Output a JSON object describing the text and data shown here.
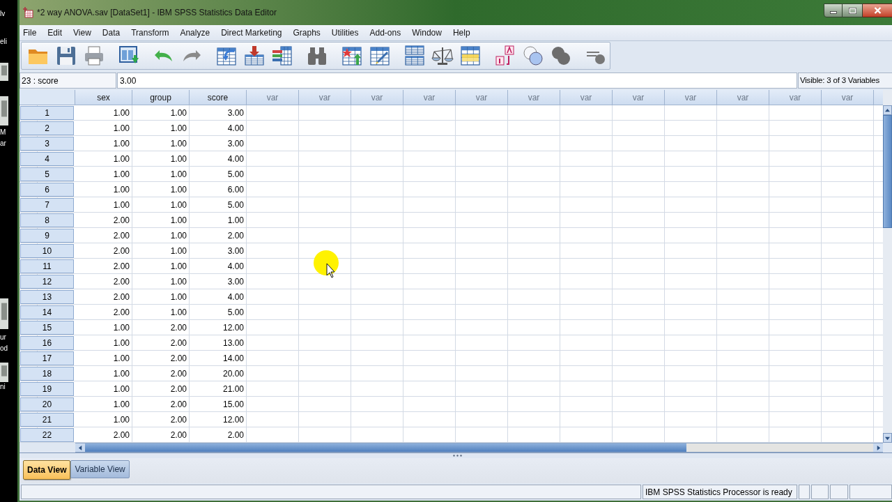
{
  "desktop": {
    "labels": [
      "lv",
      "eli",
      "M",
      "ar",
      "ur",
      "od",
      "ni"
    ]
  },
  "window": {
    "title": "*2 way ANOVA.sav [DataSet1] - IBM SPSS Statistics Data Editor"
  },
  "menu": [
    "File",
    "Edit",
    "View",
    "Data",
    "Transform",
    "Analyze",
    "Direct Marketing",
    "Graphs",
    "Utilities",
    "Add-ons",
    "Window",
    "Help"
  ],
  "cell_editor": {
    "cell": "23 : score",
    "value": "3.00",
    "visible": "Visible: 3 of 3 Variables"
  },
  "grid": {
    "columns": [
      {
        "name": "sex",
        "kind": "defined"
      },
      {
        "name": "group",
        "kind": "defined"
      },
      {
        "name": "score",
        "kind": "defined"
      },
      {
        "name": "var",
        "kind": "empty"
      },
      {
        "name": "var",
        "kind": "empty"
      },
      {
        "name": "var",
        "kind": "empty"
      },
      {
        "name": "var",
        "kind": "empty"
      },
      {
        "name": "var",
        "kind": "empty"
      },
      {
        "name": "var",
        "kind": "empty"
      },
      {
        "name": "var",
        "kind": "empty"
      },
      {
        "name": "var",
        "kind": "empty"
      },
      {
        "name": "var",
        "kind": "empty"
      },
      {
        "name": "var",
        "kind": "empty"
      },
      {
        "name": "var",
        "kind": "empty"
      },
      {
        "name": "var",
        "kind": "empty"
      }
    ],
    "rows": [
      {
        "number": "1",
        "cells": [
          "1.00",
          "1.00",
          "3.00"
        ]
      },
      {
        "number": "2",
        "cells": [
          "1.00",
          "1.00",
          "4.00"
        ]
      },
      {
        "number": "3",
        "cells": [
          "1.00",
          "1.00",
          "3.00"
        ]
      },
      {
        "number": "4",
        "cells": [
          "1.00",
          "1.00",
          "4.00"
        ]
      },
      {
        "number": "5",
        "cells": [
          "1.00",
          "1.00",
          "5.00"
        ]
      },
      {
        "number": "6",
        "cells": [
          "1.00",
          "1.00",
          "6.00"
        ]
      },
      {
        "number": "7",
        "cells": [
          "1.00",
          "1.00",
          "5.00"
        ]
      },
      {
        "number": "8",
        "cells": [
          "2.00",
          "1.00",
          "1.00"
        ]
      },
      {
        "number": "9",
        "cells": [
          "2.00",
          "1.00",
          "2.00"
        ]
      },
      {
        "number": "10",
        "cells": [
          "2.00",
          "1.00",
          "3.00"
        ]
      },
      {
        "number": "11",
        "cells": [
          "2.00",
          "1.00",
          "4.00"
        ]
      },
      {
        "number": "12",
        "cells": [
          "2.00",
          "1.00",
          "3.00"
        ]
      },
      {
        "number": "13",
        "cells": [
          "2.00",
          "1.00",
          "4.00"
        ]
      },
      {
        "number": "14",
        "cells": [
          "2.00",
          "1.00",
          "5.00"
        ]
      },
      {
        "number": "15",
        "cells": [
          "1.00",
          "2.00",
          "12.00"
        ]
      },
      {
        "number": "16",
        "cells": [
          "1.00",
          "2.00",
          "13.00"
        ]
      },
      {
        "number": "17",
        "cells": [
          "1.00",
          "2.00",
          "14.00"
        ]
      },
      {
        "number": "18",
        "cells": [
          "1.00",
          "2.00",
          "20.00"
        ]
      },
      {
        "number": "19",
        "cells": [
          "1.00",
          "2.00",
          "21.00"
        ]
      },
      {
        "number": "20",
        "cells": [
          "1.00",
          "2.00",
          "15.00"
        ]
      },
      {
        "number": "21",
        "cells": [
          "1.00",
          "2.00",
          "12.00"
        ]
      },
      {
        "number": "22",
        "cells": [
          "2.00",
          "2.00",
          "2.00"
        ]
      }
    ]
  },
  "tabs": [
    {
      "label": "Data View",
      "selected": true
    },
    {
      "label": "Variable View",
      "selected": false
    }
  ],
  "status_bar": {
    "message": "IBM SPSS Statistics Processor is ready"
  }
}
